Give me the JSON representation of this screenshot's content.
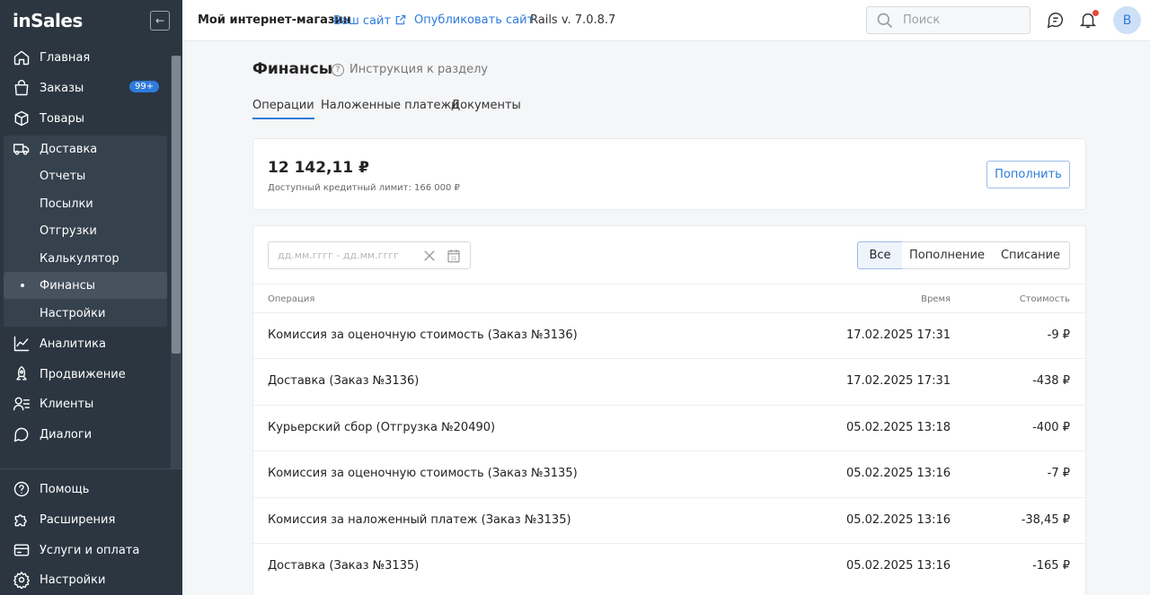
{
  "sidebar": {
    "logo": "inSales",
    "collapse_icon": "collapse-left-icon",
    "items": [
      {
        "label": "Главная",
        "icon": "home-icon"
      },
      {
        "label": "Заказы",
        "icon": "bag-icon",
        "badge": "99+"
      },
      {
        "label": "Товары",
        "icon": "box-icon"
      },
      {
        "label": "Доставка",
        "icon": "truck-icon"
      },
      {
        "label": "Аналитика",
        "icon": "chart-icon"
      },
      {
        "label": "Продвижение",
        "icon": "rocket-icon"
      },
      {
        "label": "Клиенты",
        "icon": "users-icon"
      },
      {
        "label": "Диалоги",
        "icon": "chat-icon"
      }
    ],
    "delivery_sub": [
      {
        "label": "Отчеты"
      },
      {
        "label": "Посылки"
      },
      {
        "label": "Отгрузки"
      },
      {
        "label": "Калькулятор"
      },
      {
        "label": "Финансы",
        "active": true
      },
      {
        "label": "Настройки"
      }
    ],
    "bottom": [
      {
        "label": "Помощь",
        "icon": "help-icon"
      },
      {
        "label": "Расширения",
        "icon": "puzzle-icon"
      },
      {
        "label": "Услуги и оплата",
        "icon": "card-icon"
      },
      {
        "label": "Настройки",
        "icon": "gear-icon"
      }
    ]
  },
  "topbar": {
    "store": "Мой интернет-магазин",
    "your_site": "Ваш сайт",
    "publish": "Опубликовать сайт",
    "rails": "Rails v. 7.0.8.7",
    "search_placeholder": "Поиск",
    "avatar": "B"
  },
  "page": {
    "title": "Финансы",
    "help": "Инструкция к разделу",
    "tabs": [
      "Операции",
      "Наложенные платежи",
      "Документы"
    ]
  },
  "balance": {
    "amount": "12 142,11 ₽",
    "credit": "Доступный кредитный лимит: 166 000 ₽",
    "topup_label": "Пополнить"
  },
  "filters": {
    "date_placeholder": "дд.мм.гггг - дд.мм.гггг",
    "segments": [
      "Все",
      "Пополнение",
      "Списание"
    ],
    "active_segment": "Все"
  },
  "table": {
    "headers": {
      "op": "Операция",
      "time": "Время",
      "cost": "Стоимость"
    },
    "rows": [
      {
        "op": "Комиссия за оценочную стоимость (Заказ №3136)",
        "time": "17.02.2025 17:31",
        "cost": "-9 ₽"
      },
      {
        "op": "Доставка (Заказ №3136)",
        "time": "17.02.2025 17:31",
        "cost": "-438 ₽"
      },
      {
        "op": "Курьерский сбор (Отгрузка №20490)",
        "time": "05.02.2025 13:18",
        "cost": "-400 ₽"
      },
      {
        "op": "Комиссия за оценочную стоимость (Заказ №3135)",
        "time": "05.02.2025 13:16",
        "cost": "-7 ₽"
      },
      {
        "op": "Комиссия за наложенный платеж (Заказ №3135)",
        "time": "05.02.2025 13:16",
        "cost": "-38,45 ₽"
      },
      {
        "op": "Доставка (Заказ №3135)",
        "time": "05.02.2025 13:16",
        "cost": "-165 ₽"
      }
    ]
  },
  "colors": {
    "accent": "#2f7bdb",
    "sidebar": "#2b3641",
    "badge": "#2f7bdb",
    "notification": "#e5483a"
  }
}
